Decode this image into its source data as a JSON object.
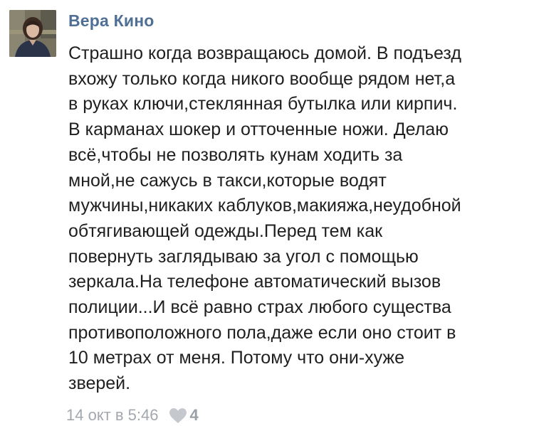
{
  "post": {
    "author": "Вера Кино",
    "text_lines": [
      "Страшно когда возвращаюсь домой. В подъезд",
      "вхожу только когда никого вообще рядом нет,а",
      "в руках ключи,стеклянная бутылка или кирпич.",
      "В карманах шокер и отточенные ножи. Делаю",
      "всё,чтобы не позволять кунам ходить за",
      "мной,не сажусь в такси,которые водят",
      "мужчины,никаких каблуков,макияжа,неудобной",
      "обтягивающей одежды.Перед тем как",
      "повернуть заглядываю за угол с помощью",
      "зеркала.На телефоне автоматический вызов",
      "полиции...И всё равно страх любого существа",
      "противоположного пола,даже если оно стоит в",
      "10 метрах от меня. Потому что они-хуже",
      "зверей."
    ],
    "timestamp": "14 окт в 5:46",
    "like_icon": "heart-icon",
    "like_count": "4"
  },
  "colors": {
    "author_link": "#4f6f95",
    "body_text": "#1f1f1f",
    "meta_text": "#a3a8ae",
    "heart": "#c5c9ce"
  }
}
